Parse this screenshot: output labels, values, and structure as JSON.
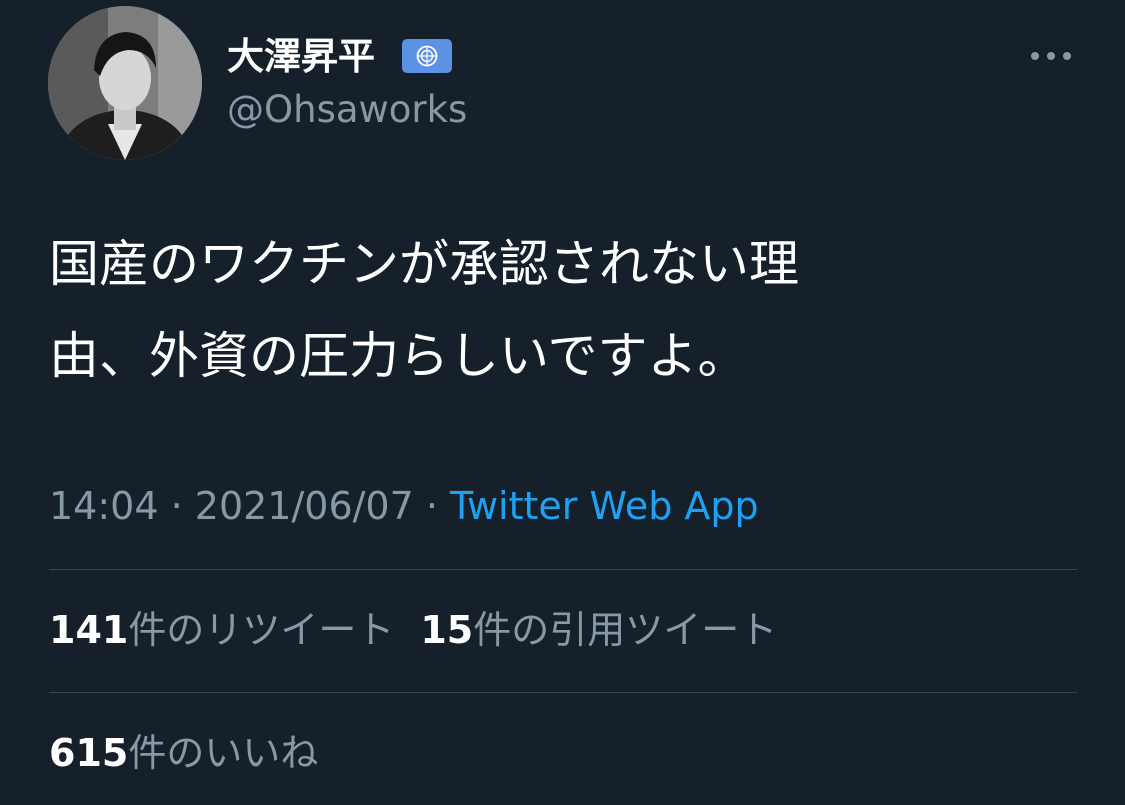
{
  "user": {
    "display_name": "大澤昇平",
    "handle": "@Ohsaworks",
    "flag_icon": "united-nations-flag-emoji"
  },
  "tweet": {
    "text_lines": [
      "国産のワクチンが承認されない理",
      "由、外資の圧力らしいですよ。"
    ]
  },
  "meta": {
    "time": "14:04",
    "separator": " · ",
    "date": "2021/06/07",
    "source": "Twitter Web App"
  },
  "stats": {
    "retweets": {
      "count": "141",
      "label": "件のリツイート"
    },
    "quotes": {
      "count": "15",
      "label": "件の引用ツイート"
    },
    "likes": {
      "count": "615",
      "label": "件のいいね"
    }
  },
  "colors": {
    "background": "#15202b",
    "text": "#ffffff",
    "secondary": "#8899a6",
    "link": "#1da1f2",
    "divider": "#38444d",
    "flag": "#5b92e5"
  }
}
